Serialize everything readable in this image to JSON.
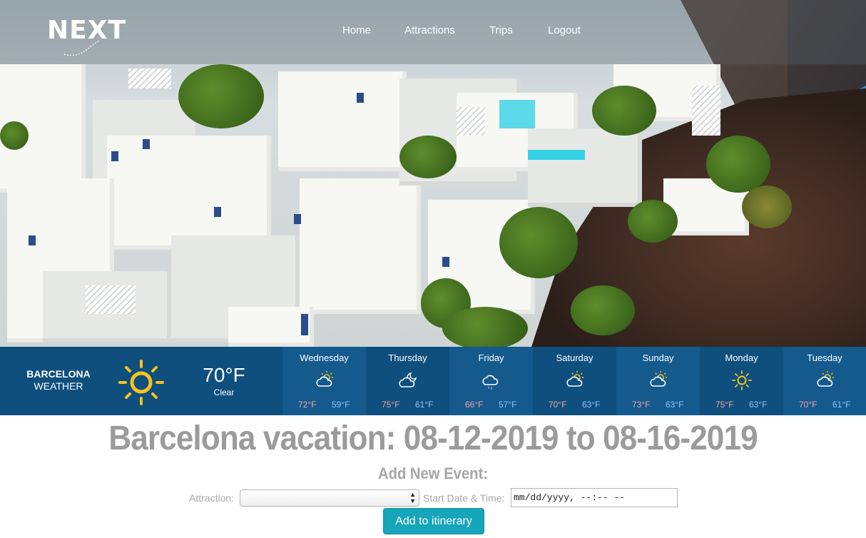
{
  "brand": {
    "logo_text": "NEXT"
  },
  "nav": {
    "links": [
      {
        "label": "Home"
      },
      {
        "label": "Attractions"
      },
      {
        "label": "Trips"
      },
      {
        "label": "Logout"
      }
    ]
  },
  "weather": {
    "city": "BARCELONA",
    "subtitle": "WEATHER",
    "current_temp": "70°F",
    "current_condition": "Clear",
    "current_icon": "sun-icon",
    "colors": {
      "bar": "#0e4f7e",
      "high": "#f3a2a6",
      "low": "#8ec3ff",
      "sun": "#f6c21c"
    },
    "forecast": [
      {
        "day": "Wednesday",
        "icon": "partly-cloudy-icon",
        "high": "72°F",
        "low": "59°F"
      },
      {
        "day": "Thursday",
        "icon": "cloud-moon-icon",
        "high": "75°F",
        "low": "61°F"
      },
      {
        "day": "Friday",
        "icon": "cloud-rain-icon",
        "high": "66°F",
        "low": "57°F"
      },
      {
        "day": "Saturday",
        "icon": "partly-cloudy-icon",
        "high": "70°F",
        "low": "63°F"
      },
      {
        "day": "Sunday",
        "icon": "partly-cloudy-icon",
        "high": "73°F",
        "low": "63°F"
      },
      {
        "day": "Monday",
        "icon": "sun-icon",
        "high": "75°F",
        "low": "63°F"
      },
      {
        "day": "Tuesday",
        "icon": "partly-cloudy-icon",
        "high": "70°F",
        "low": "61°F"
      }
    ]
  },
  "trip": {
    "title": "Barcelona vacation: 08-12-2019 to 08-16-2019"
  },
  "event_form": {
    "heading": "Add New Event:",
    "attraction_label": "Attraction:",
    "attraction_value": "",
    "date_label": "Start Date & Time:",
    "date_value": "mm/dd/yyyy, --:-- --",
    "submit_label": "Add to itinerary",
    "accent": "#17a5b9"
  }
}
